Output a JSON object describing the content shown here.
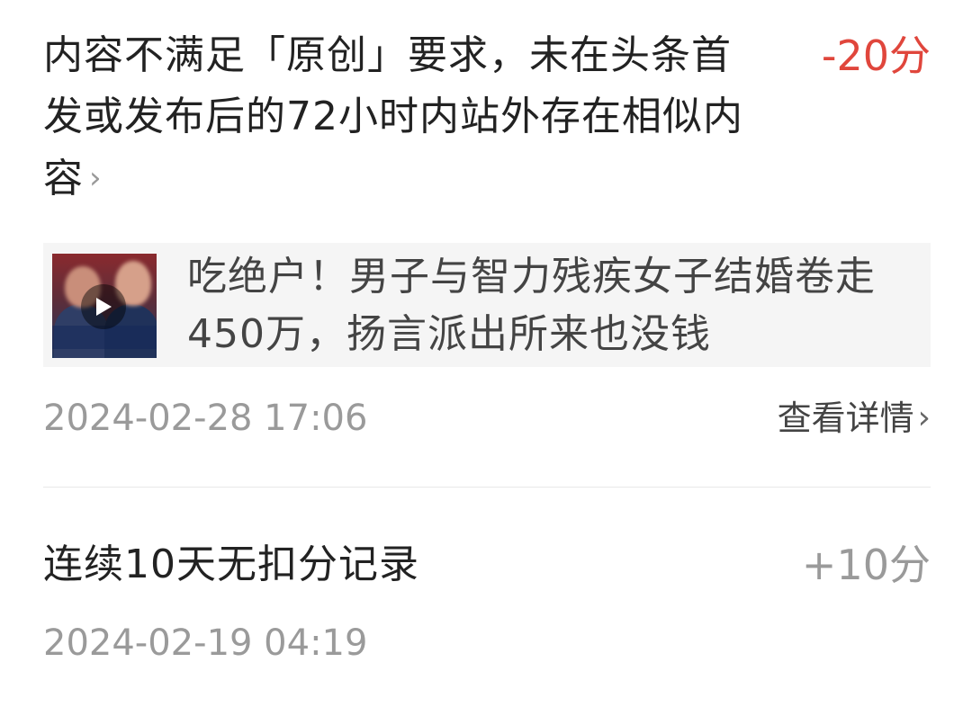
{
  "records": [
    {
      "reason": "内容不满足「原创」要求，未在头条首发或发布后的72小时内站外存在相似内容",
      "score": "-20分",
      "article": {
        "title": "吃绝户！男子与智力残疾女子结婚卷走450万，扬言派出所来也没钱",
        "thumbnail_icon": "video-thumbnail",
        "play_icon": "play-icon"
      },
      "timestamp": "2024-02-28 17:06",
      "detail_label": "查看详情"
    },
    {
      "reason": "连续10天无扣分记录",
      "score": "+10分",
      "timestamp": "2024-02-19 04:19"
    }
  ],
  "colors": {
    "negative_score": "#e0463c",
    "positive_score": "#9a9a9a",
    "text_primary": "#222222",
    "text_secondary": "#9a9a9a",
    "card_bg": "#f5f5f5",
    "divider": "#e8e8e8"
  }
}
